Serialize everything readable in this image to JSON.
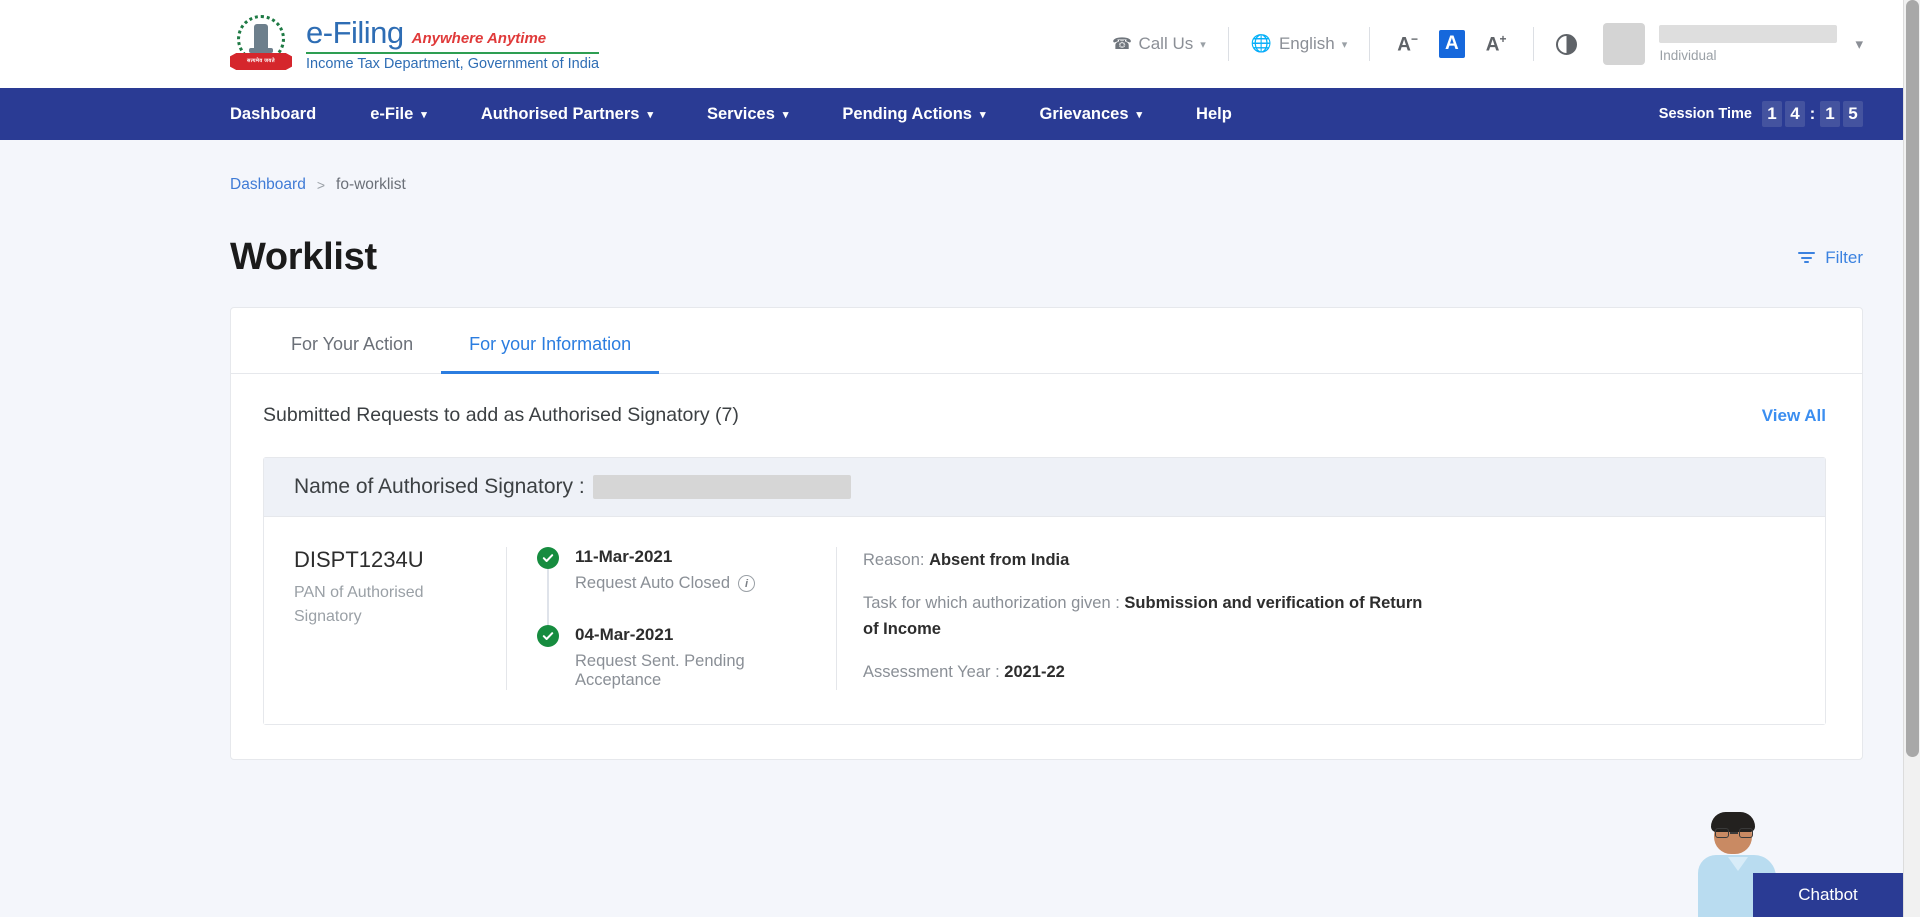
{
  "header": {
    "logo": {
      "emblem_text": "सत्यमेव जयते",
      "brand": "e-Filing",
      "tagline": "Anywhere Anytime",
      "subtitle": "Income Tax Department, Government of India"
    },
    "call_us": "Call Us",
    "language": "English",
    "font_decrease": "A",
    "font_normal": "A",
    "font_increase": "A",
    "account_type": "Individual"
  },
  "nav": {
    "items": [
      {
        "label": "Dashboard",
        "has_dropdown": false
      },
      {
        "label": "e-File",
        "has_dropdown": true
      },
      {
        "label": "Authorised Partners",
        "has_dropdown": true
      },
      {
        "label": "Services",
        "has_dropdown": true
      },
      {
        "label": "Pending Actions",
        "has_dropdown": true
      },
      {
        "label": "Grievances",
        "has_dropdown": true
      },
      {
        "label": "Help",
        "has_dropdown": false
      }
    ],
    "session_label": "Session Time",
    "session_digits": [
      "1",
      "4",
      ":",
      "1",
      "5"
    ],
    "session_time": "14:15"
  },
  "breadcrumb": {
    "root": "Dashboard",
    "separator": ">",
    "current": "fo-worklist"
  },
  "page": {
    "title": "Worklist",
    "filter_label": "Filter"
  },
  "tabs": [
    {
      "label": "For Your Action",
      "active": false
    },
    {
      "label": "For your Information",
      "active": true
    }
  ],
  "section": {
    "title": "Submitted Requests to add as Authorised Signatory (7)",
    "view_all": "View All"
  },
  "request": {
    "head_label": "Name of Authorised Signatory :",
    "pan_value": "DISPT1234U",
    "pan_label": "PAN of Authorised Signatory",
    "timeline": [
      {
        "date": "11-Mar-2021",
        "status": "Request Auto Closed",
        "has_info": true
      },
      {
        "date": "04-Mar-2021",
        "status": "Request Sent. Pending Acceptance",
        "has_info": false
      }
    ],
    "details": [
      {
        "label": "Reason:",
        "value": "Absent from India"
      },
      {
        "label": "Task for which authorization given :",
        "value": "Submission and verification of Return of Income"
      },
      {
        "label": "Assessment Year :",
        "value": "2021-22"
      }
    ]
  },
  "chatbot": {
    "label": "Chatbot"
  },
  "colors": {
    "nav_blue": "#2a3b94",
    "link_blue": "#3b8ef0",
    "accent_blue": "#2b7de0",
    "success_green": "#168c3f",
    "page_bg": "#f4f6fb"
  }
}
